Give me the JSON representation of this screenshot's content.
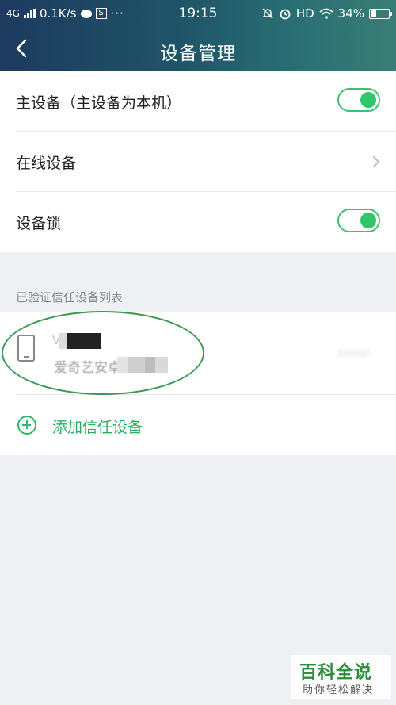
{
  "status_bar": {
    "network": "4G",
    "speed": "0.1K/s",
    "time": "19:15",
    "hd": "HD",
    "battery": "34%"
  },
  "header": {
    "title": "设备管理"
  },
  "settings": {
    "main_device": {
      "label": "主设备（主设备为本机）",
      "enabled": true
    },
    "online_devices": {
      "label": "在线设备"
    },
    "device_lock": {
      "label": "设备锁",
      "enabled": true
    }
  },
  "trusted": {
    "section_title": "已验证信任设备列表",
    "device": {
      "name_prefix": "V",
      "subtitle": "爱奇艺安卓"
    },
    "add_label": "添加信任设备"
  },
  "watermark": {
    "title": "百科全说",
    "subtitle": "助你轻松解决"
  },
  "colors": {
    "accent_green": "#2ec86a",
    "header_gradient_start": "#1d3a5f",
    "header_gradient_end": "#3a7d75"
  }
}
